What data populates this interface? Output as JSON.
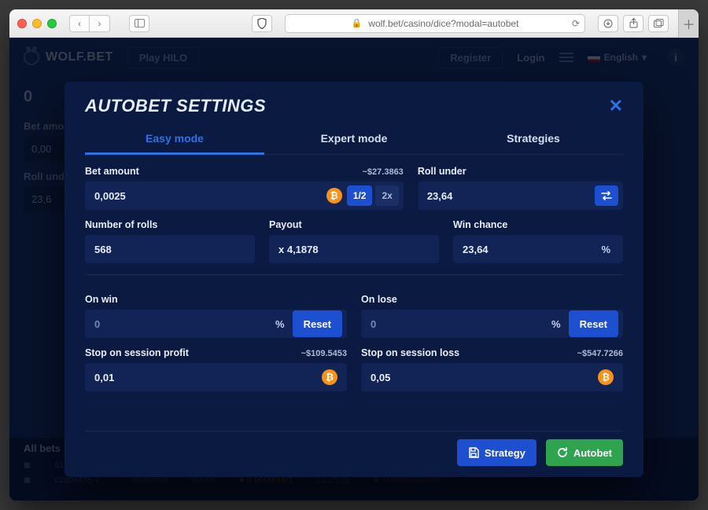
{
  "browser": {
    "url": "wolf.bet/casino/dice?modal=autobet"
  },
  "app": {
    "brand": "WOLF.BET",
    "play_btn": "Play HILO",
    "register": "Register",
    "login": "Login",
    "language": "English",
    "bg_labels": {
      "bet_amount": "Bet amount",
      "bet_amount_val": "0,00",
      "roll_under": "Roll under",
      "roll_under_val": "23,6",
      "all_bets": "All bets"
    }
  },
  "modal": {
    "title": "AUTOBET SETTINGS",
    "tabs": {
      "easy": "Easy mode",
      "expert": "Expert mode",
      "strategies": "Strategies"
    },
    "bet_amount": {
      "label": "Bet amount",
      "usd": "~$27.3863",
      "value": "0,0025",
      "half": "1/2",
      "double": "2x"
    },
    "roll_under": {
      "label": "Roll under",
      "value": "23,64"
    },
    "num_rolls": {
      "label": "Number of rolls",
      "value": "568"
    },
    "payout": {
      "label": "Payout",
      "value": "x 4,1878"
    },
    "win_chance": {
      "label": "Win chance",
      "value": "23,64",
      "suffix": "%"
    },
    "on_win": {
      "label": "On win",
      "value": "0",
      "suffix": "%",
      "reset": "Reset"
    },
    "on_lose": {
      "label": "On lose",
      "value": "0",
      "suffix": "%",
      "reset": "Reset"
    },
    "stop_profit": {
      "label": "Stop on session profit",
      "usd": "~$109.5453",
      "value": "0,01"
    },
    "stop_loss": {
      "label": "Stop on session loss",
      "usd": "~$547.7266",
      "value": "0,05"
    },
    "actions": {
      "strategy": "Strategy",
      "autobet": "Autobet"
    }
  }
}
